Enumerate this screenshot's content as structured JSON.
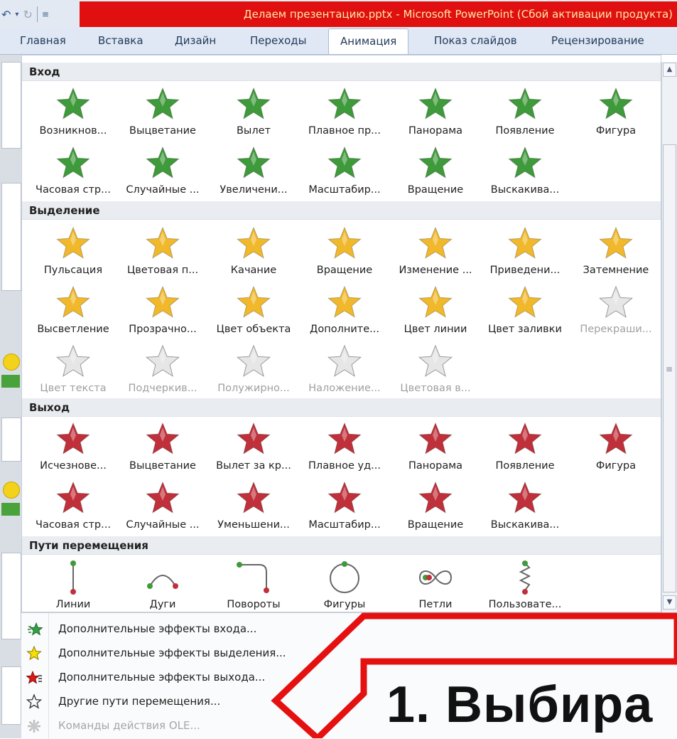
{
  "window": {
    "title": "Делаем презентацию.pptx - Microsoft PowerPoint (Сбой активации продукта)"
  },
  "ribbon_tabs": [
    {
      "label": "Главная",
      "active": false
    },
    {
      "label": "Вставка",
      "active": false
    },
    {
      "label": "Дизайн",
      "active": false
    },
    {
      "label": "Переходы",
      "active": false
    },
    {
      "label": "Анимация",
      "active": true
    },
    {
      "label": "Показ слайдов",
      "active": false
    },
    {
      "label": "Рецензирование",
      "active": false
    }
  ],
  "gallery": {
    "sections": {
      "entrance": {
        "title": "Вход",
        "color": "#3e9a3a",
        "items": [
          "Возникнов...",
          "Выцветание",
          "Вылет",
          "Плавное пр...",
          "Панорама",
          "Появление",
          "Фигура",
          "Часовая стр...",
          "Случайные ...",
          "Увеличени...",
          "Масштабир...",
          "Вращение",
          "Выскакива..."
        ]
      },
      "emphasis": {
        "title": "Выделение",
        "color": "#f0b82a",
        "items": [
          "Пульсация",
          "Цветовая п...",
          "Качание",
          "Вращение",
          "Изменение ...",
          "Приведени...",
          "Затемнение",
          "Высветление",
          "Прозрачно...",
          "Цвет объекта",
          "Дополните...",
          "Цвет линии",
          "Цвет заливки",
          "Перекраши...",
          "Цвет текста",
          "Подчеркив...",
          "Полужирно...",
          "Наложение...",
          "Цветовая в..."
        ],
        "disabled_from": 13
      },
      "exit": {
        "title": "Выход",
        "color": "#c0303a",
        "items": [
          "Исчезнове...",
          "Выцветание",
          "Вылет за кр...",
          "Плавное уд...",
          "Панорама",
          "Появление",
          "Фигура",
          "Часовая стр...",
          "Случайные ...",
          "Уменьшени...",
          "Масштабир...",
          "Вращение",
          "Выскакива..."
        ]
      },
      "paths": {
        "title": "Пути перемещения",
        "items": [
          "Линии",
          "Дуги",
          "Повороты",
          "Фигуры",
          "Петли",
          "Пользовате..."
        ]
      }
    }
  },
  "menu": [
    {
      "label": "Дополнительные эффекты входа...",
      "icon": "green-star-icon",
      "enabled": true
    },
    {
      "label": "Дополнительные эффекты выделения...",
      "icon": "yellow-star-icon",
      "enabled": true
    },
    {
      "label": "Дополнительные эффекты выхода...",
      "icon": "red-star-icon",
      "enabled": true
    },
    {
      "label": "Другие пути перемещения...",
      "icon": "outline-star-icon",
      "enabled": true
    },
    {
      "label": "Команды действия OLE...",
      "icon": "gear-icon",
      "enabled": false
    }
  ],
  "annotation": {
    "caption": "1. Выбира"
  }
}
